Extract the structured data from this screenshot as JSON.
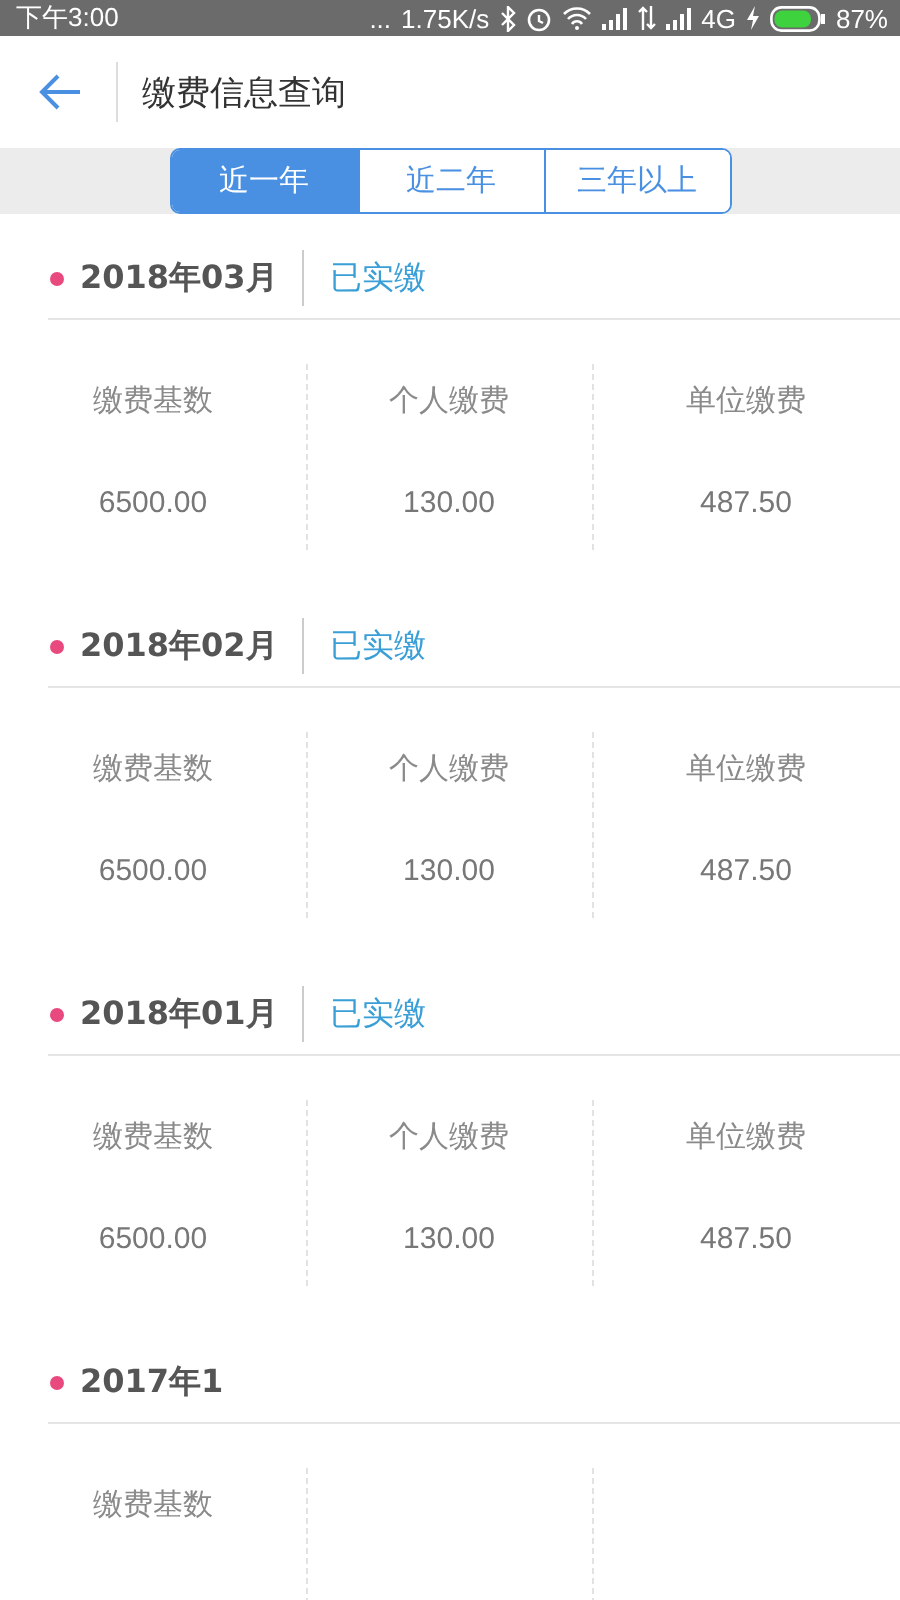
{
  "status_bar": {
    "time": "下午3:00",
    "dots": "...",
    "speed": "1.75K/s",
    "network": "4G",
    "battery": "87%"
  },
  "header": {
    "title": "缴费信息查询"
  },
  "tabs": [
    {
      "label": "近一年",
      "selected": true
    },
    {
      "label": "近二年",
      "selected": false
    },
    {
      "label": "三年以上",
      "selected": false
    }
  ],
  "records": [
    {
      "month": "2018年03月",
      "status": "已实缴",
      "cells": [
        {
          "label": "缴费基数",
          "value": "6500.00"
        },
        {
          "label": "个人缴费",
          "value": "130.00"
        },
        {
          "label": "单位缴费",
          "value": "487.50"
        }
      ]
    },
    {
      "month": "2018年02月",
      "status": "已实缴",
      "cells": [
        {
          "label": "缴费基数",
          "value": "6500.00"
        },
        {
          "label": "个人缴费",
          "value": "130.00"
        },
        {
          "label": "单位缴费",
          "value": "487.50"
        }
      ]
    },
    {
      "month": "2018年01月",
      "status": "已实缴",
      "cells": [
        {
          "label": "缴费基数",
          "value": "6500.00"
        },
        {
          "label": "个人缴费",
          "value": "130.00"
        },
        {
          "label": "单位缴费",
          "value": "487.50"
        }
      ]
    },
    {
      "month": "2017年1",
      "cells": [
        {
          "label": "缴费基数"
        }
      ]
    }
  ]
}
